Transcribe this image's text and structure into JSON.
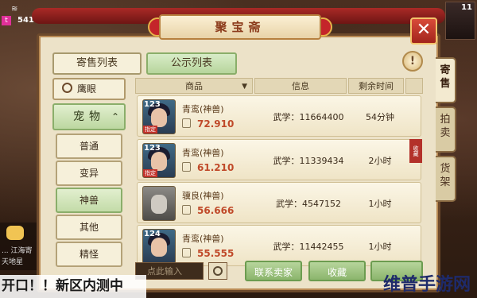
{
  "status_bar": {
    "time": "541",
    "wifi_icon": "wifi-icon",
    "badge": "t"
  },
  "portrait_label": "11",
  "chat": {
    "line1": "... 江海寄",
    "line2": "天地星"
  },
  "window": {
    "title": "聚宝斋"
  },
  "list_tabs": {
    "sale": "寄售列表",
    "public": "公示列表"
  },
  "side_tabs": [
    {
      "label": "寄售"
    },
    {
      "label": "拍卖"
    },
    {
      "label": "货架"
    }
  ],
  "search_button": "鹰眼",
  "category": {
    "header": "宠物",
    "items": [
      {
        "label": "普通"
      },
      {
        "label": "变异"
      },
      {
        "label": "神兽"
      },
      {
        "label": "其他"
      },
      {
        "label": "精怪"
      }
    ]
  },
  "table": {
    "headers": {
      "name": "商品",
      "info": "信息",
      "time": "剩余时间"
    },
    "rows": [
      {
        "level": "123",
        "tag": "指定",
        "name": "青鸾(神兽)",
        "price": "72.910",
        "info": "武学：11664400",
        "time": "54分钟"
      },
      {
        "level": "123",
        "tag": "指定",
        "name": "青鸾(神兽)",
        "price": "61.210",
        "info": "武学：11339434",
        "time": "2小时",
        "badge": "收藏"
      },
      {
        "level": "",
        "tag": "",
        "name": "骥良(神兽)",
        "price": "56.666",
        "info": "武学：4547152",
        "time": "1小时"
      },
      {
        "level": "124",
        "tag": "",
        "name": "青鸾(神兽)",
        "price": "55.555",
        "info": "武学：11442455",
        "time": "1小时"
      }
    ]
  },
  "bottom": {
    "input_placeholder": "点此输入",
    "contact": "联系卖家",
    "collect": "收藏",
    "buy": ""
  },
  "banner": "开口！！新区内测中",
  "watermark": "维普手游网"
}
